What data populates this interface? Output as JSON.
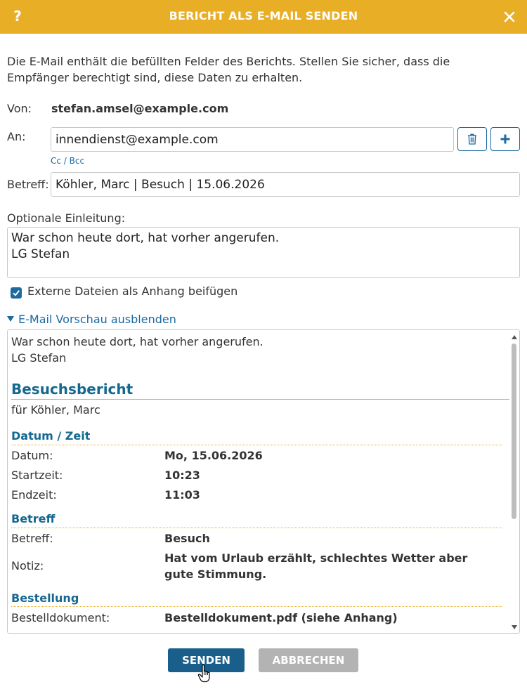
{
  "dialog": {
    "title": "BERICHT ALS E-MAIL SENDEN",
    "help_label": "?",
    "close_icon": "close-icon",
    "accent_color": "#e8ae26",
    "primary_color": "#1a5f8c"
  },
  "info_text": "Die E-Mail enthält die befüllten Felder des Berichts. Stellen Sie sicher, dass die Empfänger berechtigt sind, diese Daten zu erhalten.",
  "from": {
    "label": "Von:",
    "value": "stefan.amsel@example.com"
  },
  "to": {
    "label": "An:",
    "value": "innendienst@example.com",
    "cc_bcc_label": "Cc / Bcc",
    "delete_icon": "trash-icon",
    "add_icon": "plus-icon"
  },
  "subject": {
    "label": "Betreff:",
    "value": "Köhler, Marc | Besuch | 15.06.2026"
  },
  "intro": {
    "label": "Optionale Einleitung:",
    "value": "War schon heute dort, hat vorher angerufen.\nLG Stefan"
  },
  "attach": {
    "label": "Externe Dateien als Anhang beifügen",
    "checked": true
  },
  "preview_toggle_label": "E-Mail Vorschau ausblenden",
  "preview": {
    "intro_line1": "War schon heute dort, hat vorher angerufen.",
    "intro_line2": "LG Stefan",
    "heading": "Besuchsbericht",
    "subheading": "für Köhler, Marc",
    "sections": [
      {
        "title": "Datum / Zeit",
        "rows": [
          {
            "key": "Datum:",
            "value": "Mo, 15.06.2026"
          },
          {
            "key": "Startzeit:",
            "value": "10:23"
          },
          {
            "key": "Endzeit:",
            "value": "11:03"
          }
        ]
      },
      {
        "title": "Betreff",
        "rows": [
          {
            "key": "Betreff:",
            "value": "Besuch"
          },
          {
            "key": "Notiz:",
            "value": "Hat vom Urlaub erzählt, schlechtes Wetter aber gute Stimmung."
          }
        ]
      },
      {
        "title": "Bestellung",
        "rows": [
          {
            "key": "Bestelldokument:",
            "value": "Bestelldokument.pdf (siehe Anhang)"
          }
        ]
      }
    ]
  },
  "buttons": {
    "send": "SENDEN",
    "cancel": "ABBRECHEN"
  }
}
